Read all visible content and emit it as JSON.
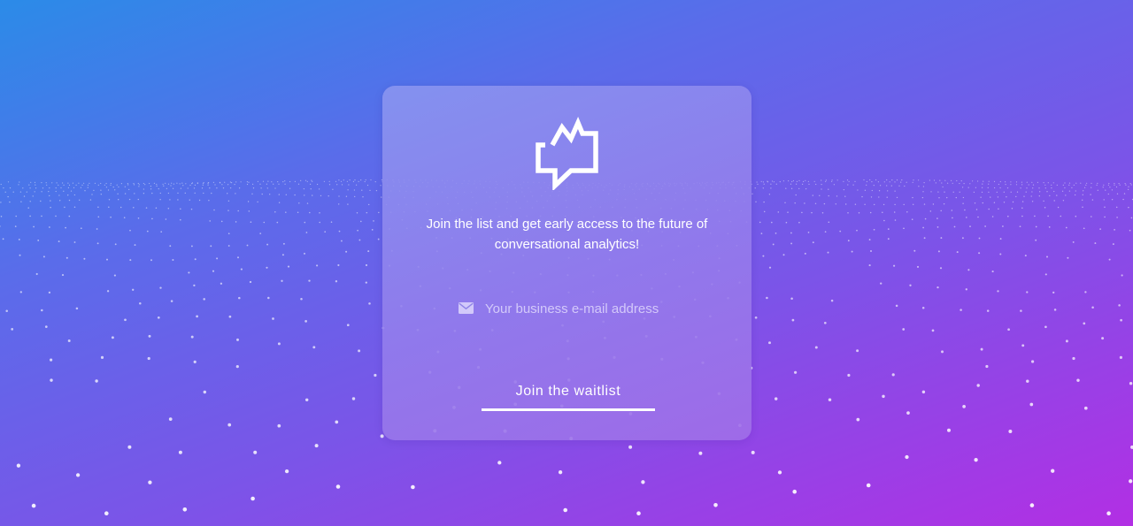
{
  "theme": {
    "accent": "#ffffff",
    "background_start": "#2b8be8",
    "background_end": "#b22fe4"
  },
  "decor": {
    "background_icon": "particle-wave-icon"
  },
  "card": {
    "logo_icon": "chat-bubble-pulse-icon",
    "headline": "Join the list and get early access to the future of conversational analytics!",
    "email": {
      "icon": "envelope-icon",
      "placeholder": "Your business e-mail address",
      "value": ""
    },
    "join_button_label": "Join the waitlist"
  }
}
